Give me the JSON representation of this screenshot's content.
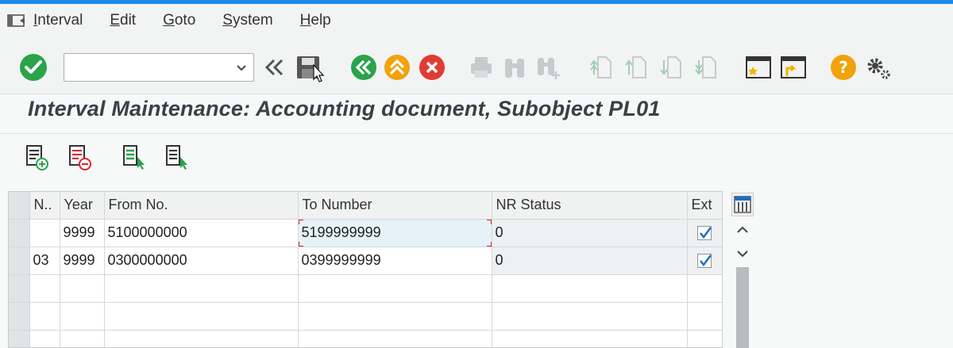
{
  "menu": {
    "items": [
      {
        "label": "Interval",
        "key": "I"
      },
      {
        "label": "Edit",
        "key": "E"
      },
      {
        "label": "Goto",
        "key": "G"
      },
      {
        "label": "System",
        "key": "S"
      },
      {
        "label": "Help",
        "key": "H"
      }
    ]
  },
  "toolbar": {
    "command_value": ""
  },
  "page": {
    "title": "Interval Maintenance: Accounting document, Subobject PL01"
  },
  "table": {
    "columns": [
      "N..",
      "Year",
      "From No.",
      "To Number",
      "NR Status",
      "Ext"
    ],
    "rows": [
      {
        "no": "",
        "year": "9999",
        "from": "5100000000",
        "to": "5199999999",
        "status": "0",
        "ext": true
      },
      {
        "no": "03",
        "year": "9999",
        "from": "0300000000",
        "to": "0399999999",
        "status": "0",
        "ext": true
      }
    ]
  },
  "colors": {
    "accent_blue": "#1b8de8",
    "ok_green": "#2aa34a",
    "cancel_red": "#e03c31",
    "exit_orange": "#f0a30a",
    "focus_red": "#d9262c"
  }
}
